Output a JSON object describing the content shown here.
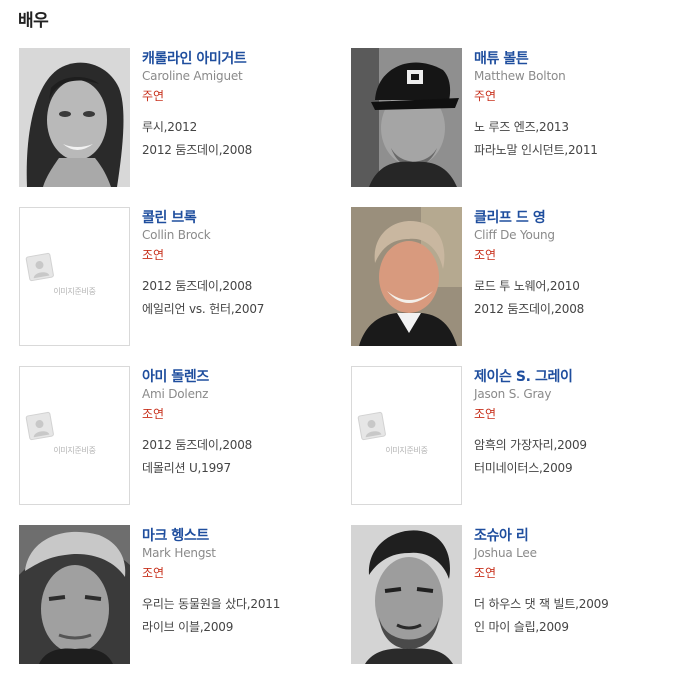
{
  "section": {
    "title": "배우"
  },
  "placeholder_text": "이미지준비중",
  "colors": {
    "name": "#1f4e9e",
    "role": "#c8321e",
    "english": "#8a8a8a",
    "work": "#444444"
  },
  "actors": [
    {
      "name_ko": "캐롤라인 아미거트",
      "name_en": "Caroline Amiguet",
      "role": "주연",
      "photo": "woman-portrait",
      "works": [
        "루시,2012",
        "2012 둠즈데이,2008"
      ]
    },
    {
      "name_ko": "매튜 볼튼",
      "name_en": "Matthew Bolton",
      "role": "주연",
      "photo": "man-cap-portrait",
      "works": [
        "노 루즈 엔즈,2013",
        "파라노말 인시던트,2011"
      ]
    },
    {
      "name_ko": "콜린 브록",
      "name_en": "Collin Brock",
      "role": "조연",
      "photo": "placeholder",
      "works": [
        "2012 둠즈데이,2008",
        "에일리언 vs. 헌터,2007"
      ]
    },
    {
      "name_ko": "클리프 드 영",
      "name_en": "Cliff De Young",
      "role": "조연",
      "photo": "man-color-portrait",
      "works": [
        "로드 투 노웨어,2010",
        "2012 둠즈데이,2008"
      ]
    },
    {
      "name_ko": "아미 돌렌즈",
      "name_en": "Ami Dolenz",
      "role": "조연",
      "photo": "placeholder",
      "works": [
        "2012 둠즈데이,2008",
        "데몰리션 U,1997"
      ]
    },
    {
      "name_ko": "제이슨 S. 그레이",
      "name_en": "Jason S. Gray",
      "role": "조연",
      "photo": "placeholder",
      "works": [
        "암흑의 가장자리,2009",
        "터미네이터스,2009"
      ]
    },
    {
      "name_ko": "마크 헹스트",
      "name_en": "Mark Hengst",
      "role": "조연",
      "photo": "man-bw-portrait",
      "works": [
        "우리는 동물원을 샀다,2011",
        "라이브 이블,2009"
      ]
    },
    {
      "name_ko": "조슈아 리",
      "name_en": "Joshua Lee",
      "role": "조연",
      "photo": "man-bw-portrait-2",
      "works": [
        "더 하우스 댓 잭 빌트,2009",
        "인 마이 슬립,2009"
      ]
    }
  ]
}
